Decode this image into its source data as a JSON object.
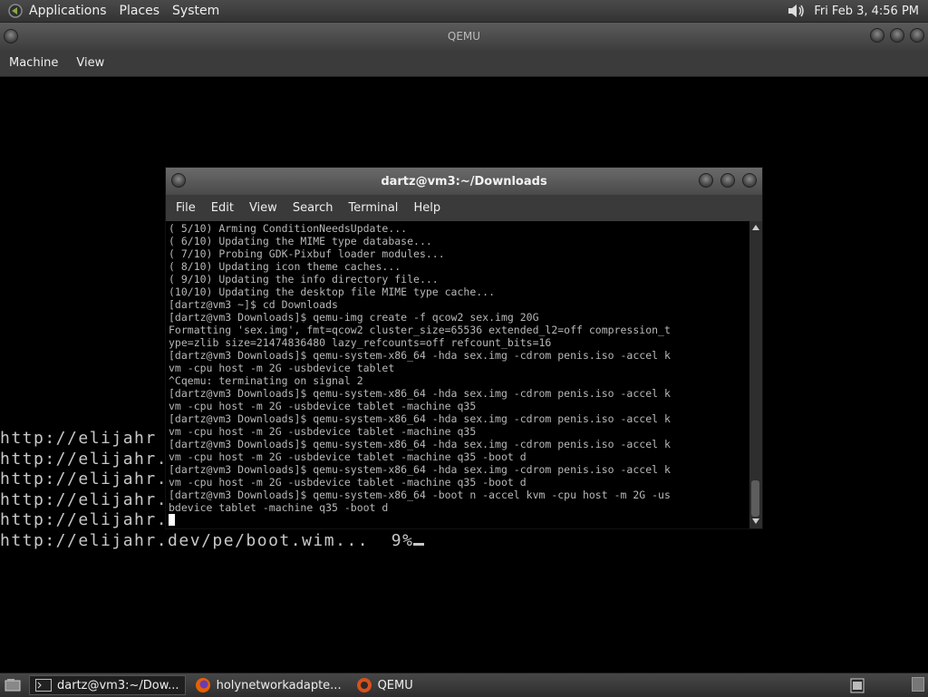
{
  "top_panel": {
    "menus": [
      "Applications",
      "Places",
      "System"
    ],
    "clock": "Fri Feb  3,  4:56 PM",
    "icons": {
      "app": "gnome-foot-icon",
      "volume": "volume-icon"
    }
  },
  "qemu": {
    "title": "QEMU",
    "menu": [
      "Machine",
      "View"
    ],
    "boot_lines": [
      "http://elijahr",
      "http://elijahr.dev/pe/bootmgr... ok",
      "http://elijahr.dev/pe/bootmgr.efi... ok",
      "http://elijahr.dev/pe/BCD... ok",
      "http://elijahr.dev/pe/boot.sdi... ok",
      "http://elijahr.dev/pe/boot.wim...  9%"
    ]
  },
  "terminal": {
    "title": "dartz@vm3:~/Downloads",
    "menu": [
      "File",
      "Edit",
      "View",
      "Search",
      "Terminal",
      "Help"
    ],
    "lines": [
      "( 5/10) Arming ConditionNeedsUpdate...",
      "( 6/10) Updating the MIME type database...",
      "( 7/10) Probing GDK-Pixbuf loader modules...",
      "( 8/10) Updating icon theme caches...",
      "( 9/10) Updating the info directory file...",
      "(10/10) Updating the desktop file MIME type cache...",
      "[dartz@vm3 ~]$ cd Downloads",
      "[dartz@vm3 Downloads]$ qemu-img create -f qcow2 sex.img 20G",
      "Formatting 'sex.img', fmt=qcow2 cluster_size=65536 extended_l2=off compression_t",
      "ype=zlib size=21474836480 lazy_refcounts=off refcount_bits=16",
      "[dartz@vm3 Downloads]$ qemu-system-x86_64 -hda sex.img -cdrom penis.iso -accel k",
      "vm -cpu host -m 2G -usbdevice tablet",
      "^Cqemu: terminating on signal 2",
      "[dartz@vm3 Downloads]$ qemu-system-x86_64 -hda sex.img -cdrom penis.iso -accel k",
      "vm -cpu host -m 2G -usbdevice tablet -machine q35",
      "[dartz@vm3 Downloads]$ qemu-system-x86_64 -hda sex.img -cdrom penis.iso -accel k",
      "vm -cpu host -m 2G -usbdevice tablet -machine q35",
      "[dartz@vm3 Downloads]$ qemu-system-x86_64 -hda sex.img -cdrom penis.iso -accel k",
      "vm -cpu host -m 2G -usbdevice tablet -machine q35 -boot d",
      "[dartz@vm3 Downloads]$ qemu-system-x86_64 -hda sex.img -cdrom penis.iso -accel k",
      "vm -cpu host -m 2G -usbdevice tablet -machine q35 -boot d",
      "[dartz@vm3 Downloads]$ qemu-system-x86_64 -boot n -accel kvm -cpu host -m 2G -us",
      "bdevice tablet -machine q35 -boot d"
    ]
  },
  "taskbar": {
    "tasks": [
      {
        "label": "dartz@vm3:~/Dow...",
        "icon": "terminal-icon"
      },
      {
        "label": "holynetworkadapte...",
        "icon": "firefox-icon"
      },
      {
        "label": "QEMU",
        "icon": "qemu-icon"
      }
    ]
  }
}
